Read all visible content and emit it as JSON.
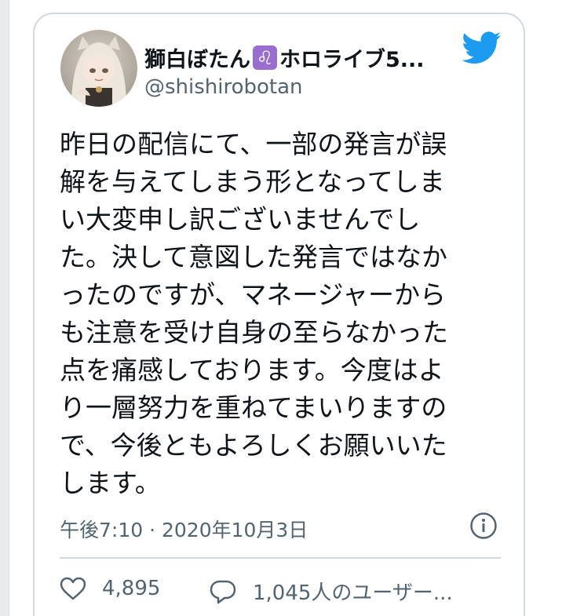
{
  "tweet": {
    "author_name_prefix": "獅白ぼたん",
    "zodiac_symbol": "♌",
    "author_name_suffix": "ホロライブ5...",
    "handle": "@shishirobotan",
    "text_lines": [
      "昨日の配信にて、一部の発言が誤",
      "解を与えてしまう形となってしま",
      "い大変申し訳ございませんでし",
      "た。決して意図した発言ではなか",
      "ったのですが、マネージャーから",
      "も注意を受け自身の至らなかった",
      "点を痛感しております。今度はよ",
      "り一層努力を重ねてまいりますの",
      "で、今後ともよろしくお願いいた",
      "します。"
    ],
    "timestamp": "午後7:10 · 2020年10月3日",
    "like_count": "4,895",
    "reply_label": "1,045人のユーザー..."
  },
  "icons": {
    "brand": "twitter-bird-icon",
    "info": "info-icon",
    "like": "heart-icon",
    "reply": "reply-bubble-icon"
  },
  "colors": {
    "brand_blue": "#1d9bf0",
    "zodiac_badge": "#9a6ed0",
    "text_primary": "#0f1419",
    "text_secondary": "#536471",
    "border": "#cfd9de"
  }
}
